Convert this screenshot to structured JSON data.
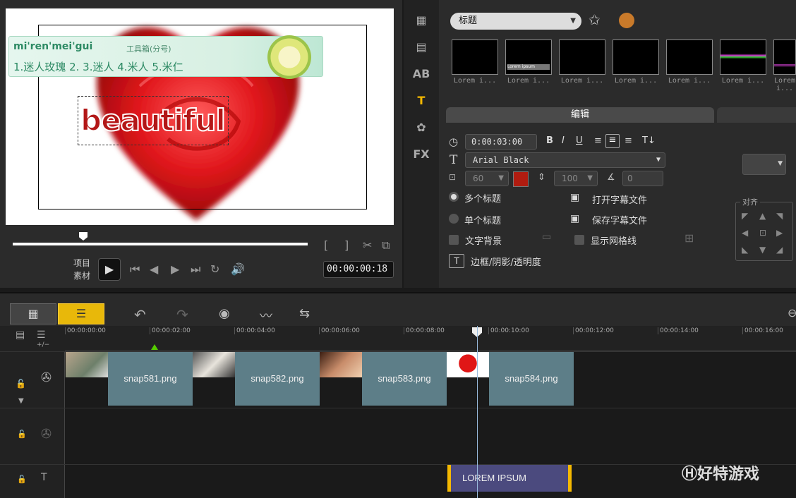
{
  "preview": {
    "title_text": "beautiful",
    "ime": {
      "pinyin": "mi'ren'mei'gui",
      "toolbox": "工具箱(分号)",
      "candidates": "1.迷人玫瑰  2.      3.迷人  4.米人  5.米仁"
    },
    "mode_project": "项目",
    "mode_clip": "素材",
    "timecode": "00:00:00:18",
    "bracket_left": "[",
    "bracket_right": "]"
  },
  "library": {
    "category": "标题",
    "thumb_label": "Lorem i...",
    "thumb_inner": "Lorem ipsum",
    "edit_tab": "编辑",
    "duration": "0:00:03:00",
    "font_name": "Arial Black",
    "font_size": "60",
    "line_spacing": "100",
    "angle": "0",
    "multi_title": "多个标题",
    "single_title": "单个标题",
    "open_subtitle": "打开字幕文件",
    "save_subtitle": "保存字幕文件",
    "text_bg": "文字背景",
    "show_grid": "显示网格线",
    "border_shadow": "边框/阴影/透明度",
    "align": "对齐",
    "color": "#b01c10"
  },
  "timeline": {
    "ticks": [
      "00:00:00:00",
      "00:00:02:00",
      "00:00:04:00",
      "00:00:06:00",
      "00:00:08:00",
      "00:00:10:00",
      "00:00:12:00",
      "00:00:14:00",
      "00:00:16:00"
    ],
    "clips": [
      "snap581.png",
      "snap582.png",
      "snap583.png",
      "snap584.png"
    ],
    "title_clip": "LOREM IPSUM",
    "add_remove": "+/−"
  },
  "watermark": "好特游戏"
}
